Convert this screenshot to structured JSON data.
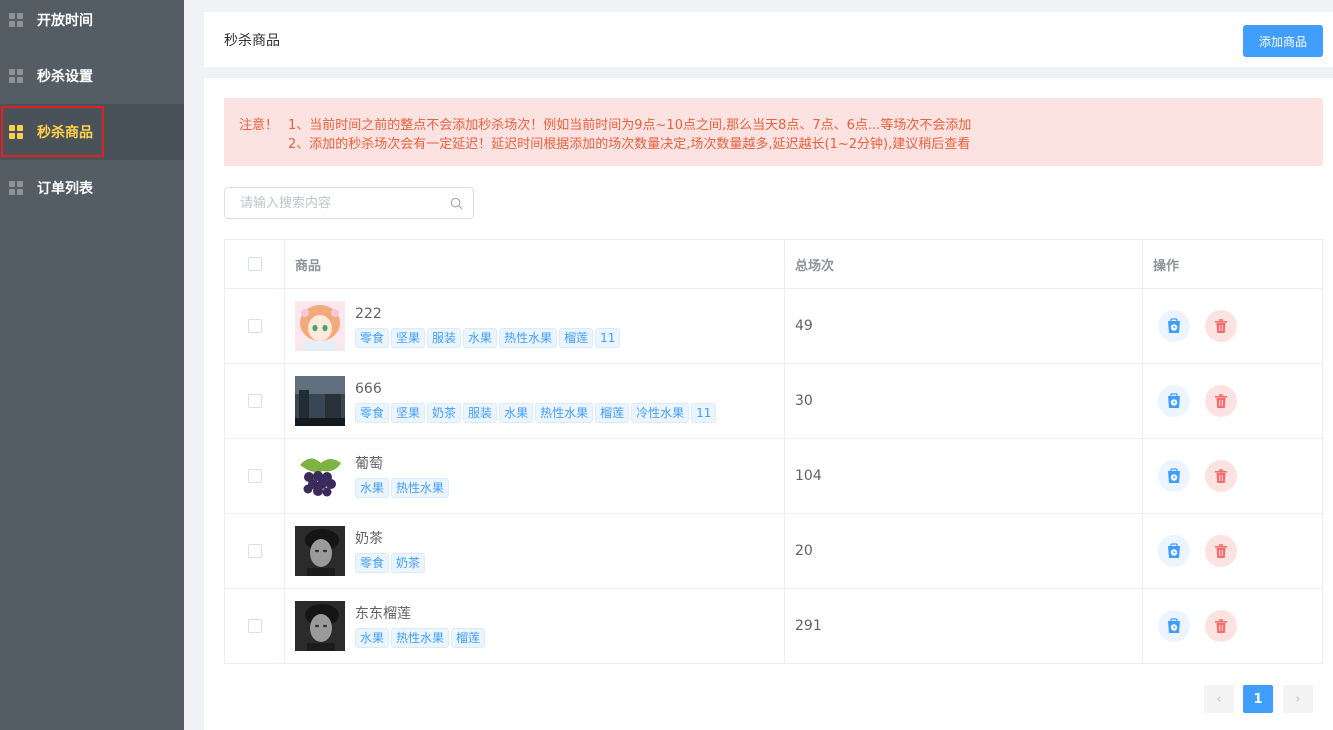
{
  "sidebar": {
    "items": [
      {
        "label": "开放时间",
        "active": false
      },
      {
        "label": "秒杀设置",
        "active": false
      },
      {
        "label": "秒杀商品",
        "active": true
      },
      {
        "label": "订单列表",
        "active": false
      }
    ]
  },
  "header": {
    "title": "秒杀商品",
    "add_button": "添加商品"
  },
  "notice": {
    "prefix": "注意！",
    "line1": "1、当前时间之前的整点不会添加秒杀场次！例如当前时间为9点~10点之间,那么当天8点、7点、6点...等场次不会添加",
    "line2": "2、添加的秒杀场次会有一定延迟！延迟时间根据添加的场次数量决定,场次数量越多,延迟越长(1~2分钟),建议稍后查看"
  },
  "search": {
    "placeholder": "请输入搜索内容",
    "value": ""
  },
  "table": {
    "columns": {
      "goods": "商品",
      "count": "总场次",
      "ops": "操作"
    },
    "rows": [
      {
        "name": "222",
        "tags": [
          "零食",
          "坚果",
          "服装",
          "水果",
          "热性水果",
          "榴莲",
          "11"
        ],
        "count": "49",
        "thumb": "anime-girl"
      },
      {
        "name": "666",
        "tags": [
          "零食",
          "坚果",
          "奶茶",
          "服装",
          "水果",
          "热性水果",
          "榴莲",
          "冷性水果",
          "11"
        ],
        "count": "30",
        "thumb": "dark-scene"
      },
      {
        "name": "葡萄",
        "tags": [
          "水果",
          "热性水果"
        ],
        "count": "104",
        "thumb": "grapes"
      },
      {
        "name": "奶茶",
        "tags": [
          "零食",
          "奶茶"
        ],
        "count": "20",
        "thumb": "portrait"
      },
      {
        "name": "东东榴莲",
        "tags": [
          "水果",
          "热性水果",
          "榴莲"
        ],
        "count": "291",
        "thumb": "portrait"
      }
    ]
  },
  "pagination": {
    "current": "1",
    "prev": "‹",
    "next": "›"
  },
  "colors": {
    "accent": "#409eff",
    "sidebar_bg": "#545c64",
    "active_text": "#ffd04b",
    "danger": "#f56c6c",
    "notice_bg": "#fde2e2"
  }
}
